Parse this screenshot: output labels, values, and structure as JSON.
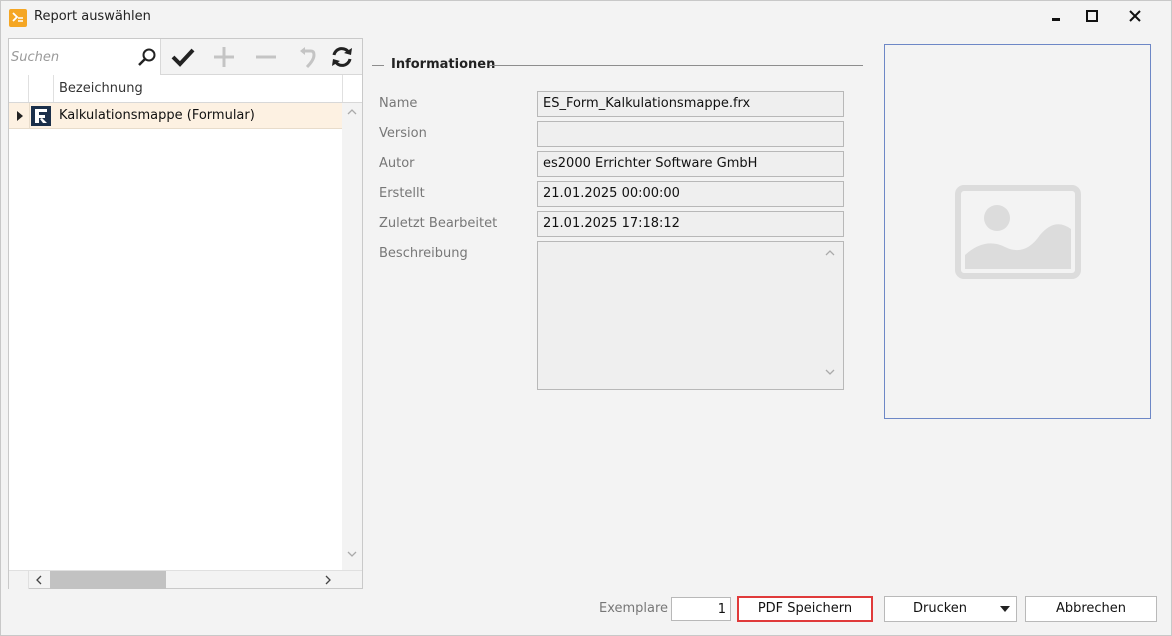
{
  "window": {
    "title": "Report auswählen"
  },
  "toolbar": {
    "search_placeholder": "Suchen",
    "search_value": ""
  },
  "grid": {
    "column_header": "Bezeichnung",
    "rows": [
      {
        "label": "Kalkulationsmappe (Formular)"
      }
    ]
  },
  "info": {
    "group_title": "Informationen",
    "fields": [
      {
        "label": "Name",
        "value": "ES_Form_Kalkulationsmappe.frx"
      },
      {
        "label": "Version",
        "value": ""
      },
      {
        "label": "Autor",
        "value": "es2000 Errichter Software GmbH"
      },
      {
        "label": "Erstellt",
        "value": "21.01.2025 00:00:00"
      },
      {
        "label": "Zuletzt Bearbeitet",
        "value": "21.01.2025 17:18:12"
      },
      {
        "label": "Beschreibung",
        "value": ""
      }
    ]
  },
  "footer": {
    "copies_label": "Exemplare",
    "copies_value": "1",
    "pdf_button": "PDF Speichern",
    "print_button": "Drucken",
    "cancel_button": "Abbrechen"
  },
  "colors": {
    "selected_row": "#fdf1e2",
    "highlight_border": "#e03a3a",
    "preview_border": "#6d87c6",
    "app_icon": "#f5a623"
  }
}
